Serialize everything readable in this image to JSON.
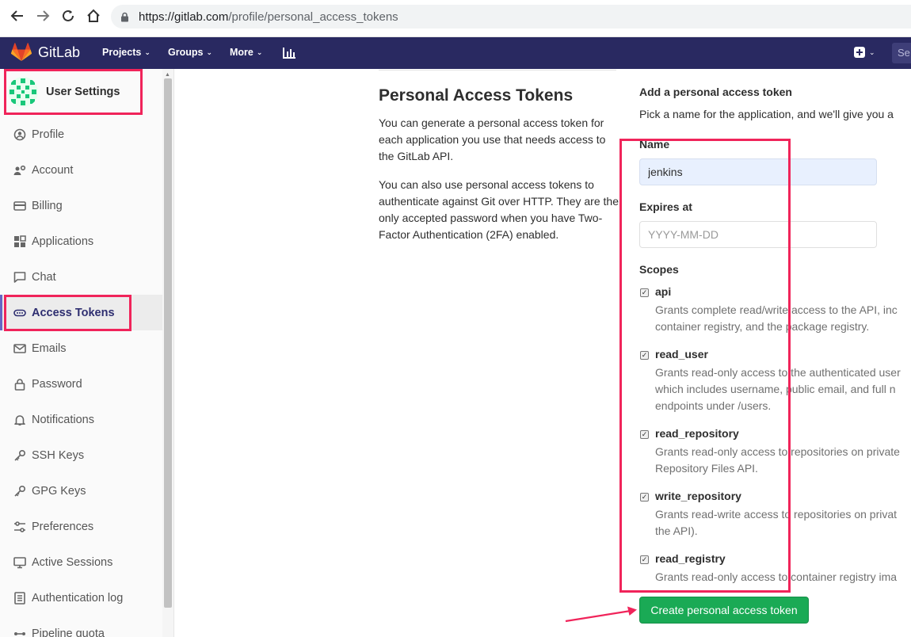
{
  "browser": {
    "url_host": "https://gitlab.com",
    "url_path": "/profile/personal_access_tokens"
  },
  "navbar": {
    "logo_text": "GitLab",
    "projects_label": "Projects",
    "groups_label": "Groups",
    "more_label": "More",
    "search_placeholder": "Se"
  },
  "sidebar": {
    "title": "User Settings",
    "items": [
      {
        "label": "Profile",
        "icon": "profile-icon"
      },
      {
        "label": "Account",
        "icon": "account-icon"
      },
      {
        "label": "Billing",
        "icon": "billing-icon"
      },
      {
        "label": "Applications",
        "icon": "applications-icon"
      },
      {
        "label": "Chat",
        "icon": "chat-icon"
      },
      {
        "label": "Access Tokens",
        "icon": "token-icon",
        "active": true
      },
      {
        "label": "Emails",
        "icon": "mail-icon"
      },
      {
        "label": "Password",
        "icon": "lock-icon"
      },
      {
        "label": "Notifications",
        "icon": "bell-icon"
      },
      {
        "label": "SSH Keys",
        "icon": "key-icon"
      },
      {
        "label": "GPG Keys",
        "icon": "key-icon"
      },
      {
        "label": "Preferences",
        "icon": "preferences-icon"
      },
      {
        "label": "Active Sessions",
        "icon": "monitor-icon"
      },
      {
        "label": "Authentication log",
        "icon": "log-icon"
      },
      {
        "label": "Pipeline quota",
        "icon": "pipeline-icon"
      }
    ]
  },
  "main": {
    "title": "Personal Access Tokens",
    "desc1": "You can generate a personal access token for each application you use that needs access to the GitLab API.",
    "desc2": "You can also use personal access tokens to authenticate against Git over HTTP. They are the only accepted password when you have Two-Factor Authentication (2FA) enabled.",
    "form": {
      "title": "Add a personal access token",
      "subtitle": "Pick a name for the application, and we'll give you a",
      "name_label": "Name",
      "name_value": "jenkins",
      "expires_label": "Expires at",
      "expires_placeholder": "YYYY-MM-DD",
      "scopes_label": "Scopes",
      "scopes": [
        {
          "name": "api",
          "checked": true,
          "desc": [
            "Grants complete read/write access to the API, inc",
            "container registry, and the package registry."
          ]
        },
        {
          "name": "read_user",
          "checked": true,
          "desc": [
            "Grants read-only access to the authenticated user",
            "which includes username, public email, and full n",
            "endpoints under /users."
          ]
        },
        {
          "name": "read_repository",
          "checked": true,
          "desc": [
            "Grants read-only access to repositories on private",
            "Repository Files API."
          ]
        },
        {
          "name": "write_repository",
          "checked": true,
          "desc": [
            "Grants read-write access to repositories on privat",
            "the API)."
          ]
        },
        {
          "name": "read_registry",
          "checked": true,
          "desc": [
            "Grants read-only access to container registry ima"
          ]
        }
      ],
      "submit_label": "Create personal access token"
    }
  },
  "colors": {
    "navbar_bg": "#292961",
    "primary_button": "#1aaa55",
    "annotation": "#f0245a"
  }
}
